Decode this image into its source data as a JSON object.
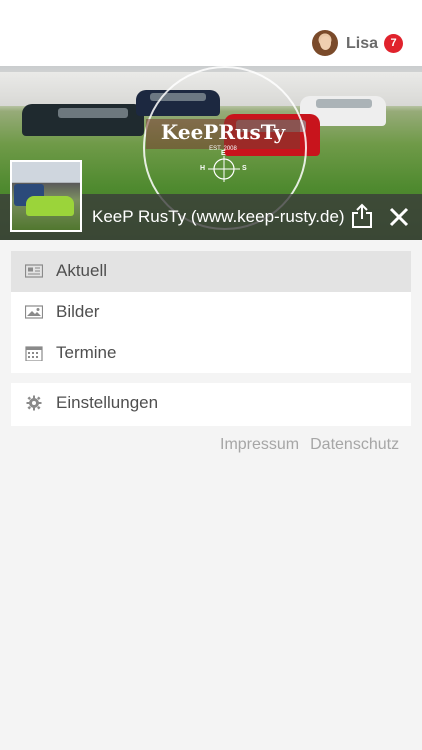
{
  "user": {
    "name": "Lisa",
    "notification_count": "7",
    "badge_color": "#e0222c"
  },
  "hero": {
    "logo_text": "KeePRusTy",
    "logo_est": "EST. 2008",
    "compass": {
      "n": "E",
      "w": "H",
      "e": "S"
    }
  },
  "page": {
    "title": "KeeP RusTy (www.keep-rusty.de)",
    "share_icon": "share-icon",
    "close_icon": "close-icon"
  },
  "menu": {
    "items": [
      {
        "label": "Aktuell",
        "icon": "newspaper-icon",
        "active": true
      },
      {
        "label": "Bilder",
        "icon": "image-icon",
        "active": false
      },
      {
        "label": "Termine",
        "icon": "calendar-icon",
        "active": false
      }
    ],
    "settings": {
      "label": "Einstellungen",
      "icon": "gear-icon"
    }
  },
  "footer": {
    "impressum": "Impressum",
    "datenschutz": "Datenschutz"
  }
}
